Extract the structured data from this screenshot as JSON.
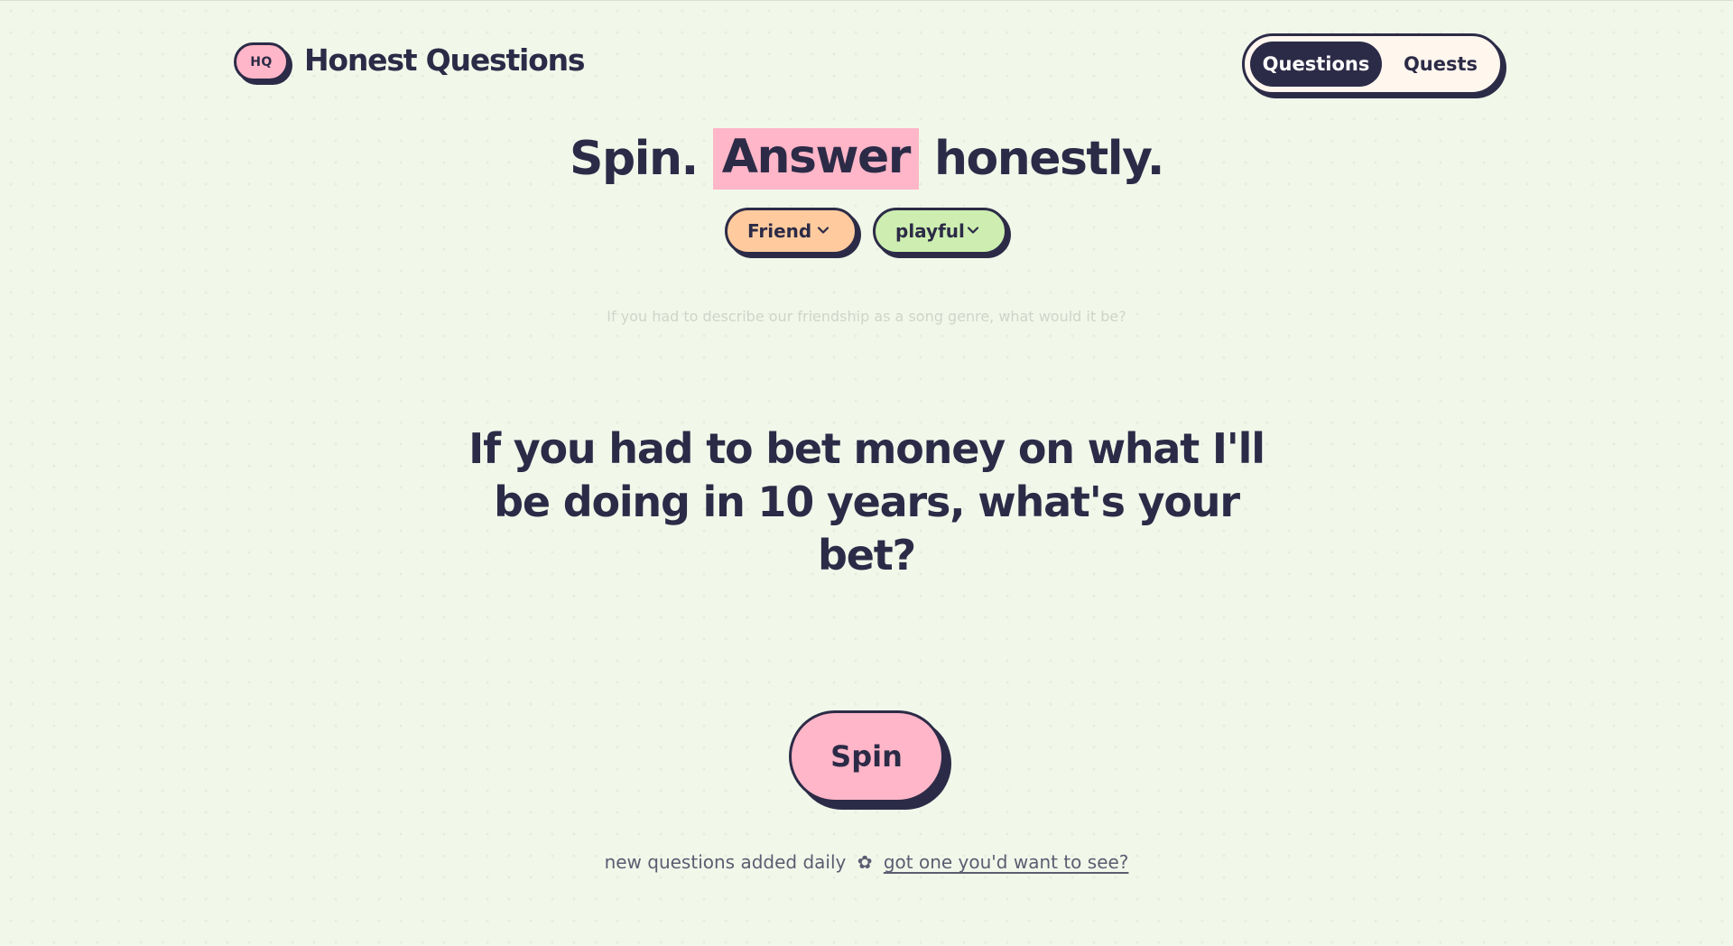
{
  "header": {
    "logo_badge": "HQ",
    "brand_name": "Honest Questions",
    "tabs": [
      {
        "label": "Questions",
        "active": true
      },
      {
        "label": "Quests",
        "active": false
      }
    ]
  },
  "hero": {
    "word1": "Spin.",
    "highlight": "Answer",
    "word3": "honestly."
  },
  "filters": {
    "relationship": {
      "selected": "Friend",
      "icon": "chevron-down-icon"
    },
    "tone": {
      "selected": "playful",
      "icon": "chevron-down-icon"
    }
  },
  "previous_question": "If you had to describe our friendship as a song genre, what would it be?",
  "current_question": "If you had to bet money on what I'll be doing in 10 years, what's your bet?",
  "spin_label": "Spin",
  "footer": {
    "text": "new questions added daily",
    "separator_icon": "flower-icon",
    "separator_glyph": "✿",
    "link": "got one you'd want to see?"
  },
  "colors": {
    "background": "#f1f8ea",
    "ink": "#2c2b47",
    "pink": "#ffb6c8",
    "peach": "#ffcb9e",
    "mint": "#cdeeb0",
    "cream": "#fff6ee"
  }
}
